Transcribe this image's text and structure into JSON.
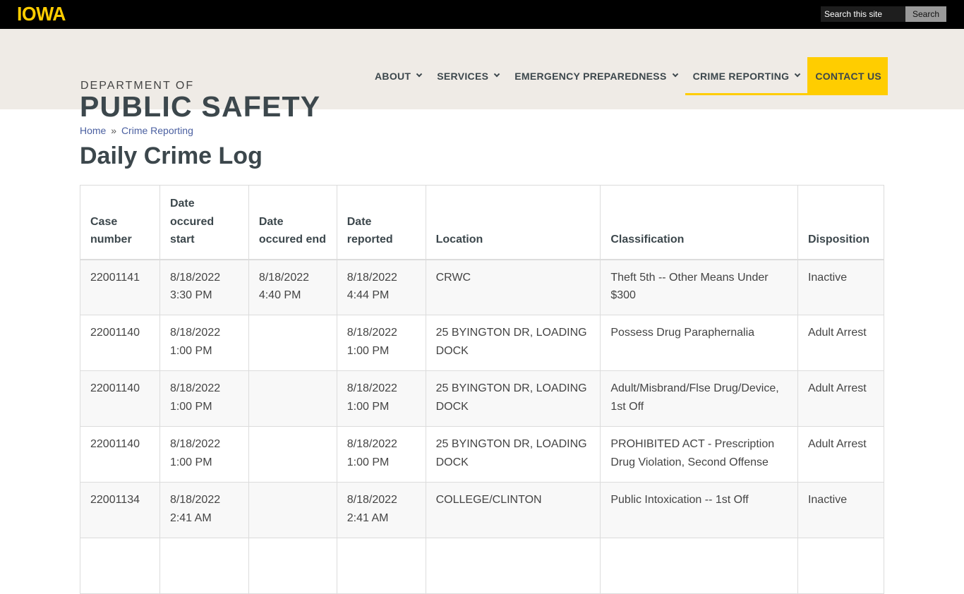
{
  "topbar": {
    "logo": "IOWA",
    "search_placeholder": "Search this site",
    "search_button": "Search"
  },
  "header": {
    "dept_of": "DEPARTMENT OF",
    "title": "PUBLIC SAFETY",
    "nav": [
      {
        "label": "ABOUT",
        "has_dropdown": true
      },
      {
        "label": "SERVICES",
        "has_dropdown": true
      },
      {
        "label": "EMERGENCY PREPAREDNESS",
        "has_dropdown": true
      },
      {
        "label": "CRIME REPORTING",
        "has_dropdown": true,
        "active": true
      },
      {
        "label": "CONTACT US",
        "has_dropdown": false
      }
    ],
    "accent_color": "#FFCD00"
  },
  "breadcrumb": {
    "home": "Home",
    "separator": "»",
    "current": "Crime Reporting"
  },
  "page_title": "Daily Crime Log",
  "table": {
    "headers": [
      "Case number",
      "Date occured start",
      "Date occured end",
      "Date reported",
      "Location",
      "Classification",
      "Disposition"
    ],
    "rows": [
      {
        "case": "22001141",
        "start_date": "8/18/2022",
        "start_time": "3:30 PM",
        "end_date": "8/18/2022",
        "end_time": "4:40 PM",
        "reported_date": "8/18/2022",
        "reported_time": "4:44 PM",
        "location": "CRWC",
        "classification": "Theft 5th -- Other Means Under $300",
        "disposition": "Inactive"
      },
      {
        "case": "22001140",
        "start_date": "8/18/2022",
        "start_time": "1:00 PM",
        "end_date": "",
        "end_time": "",
        "reported_date": "8/18/2022",
        "reported_time": "1:00 PM",
        "location": "25 BYINGTON DR, LOADING DOCK",
        "classification": "Possess Drug Paraphernalia",
        "disposition": "Adult Arrest"
      },
      {
        "case": "22001140",
        "start_date": "8/18/2022",
        "start_time": "1:00 PM",
        "end_date": "",
        "end_time": "",
        "reported_date": "8/18/2022",
        "reported_time": "1:00 PM",
        "location": "25 BYINGTON DR, LOADING DOCK",
        "classification": "Adult/Misbrand/Flse Drug/Device, 1st Off",
        "disposition": "Adult Arrest"
      },
      {
        "case": "22001140",
        "start_date": "8/18/2022",
        "start_time": "1:00 PM",
        "end_date": "",
        "end_time": "",
        "reported_date": "8/18/2022",
        "reported_time": "1:00 PM",
        "location": "25 BYINGTON DR, LOADING DOCK",
        "classification": "PROHIBITED ACT - Prescription Drug Violation, Second Offense",
        "disposition": "Adult Arrest"
      },
      {
        "case": "22001134",
        "start_date": "8/18/2022",
        "start_time": "2:41 AM",
        "end_date": "",
        "end_time": "",
        "reported_date": "8/18/2022",
        "reported_time": "2:41 AM",
        "location": "COLLEGE/CLINTON",
        "classification": "Public Intoxication -- 1st Off",
        "disposition": "Inactive"
      },
      {
        "case": "",
        "start_date": "",
        "start_time": "",
        "end_date": "",
        "end_time": "",
        "reported_date": "",
        "reported_time": "",
        "location": "",
        "classification": "",
        "disposition": ""
      }
    ]
  }
}
